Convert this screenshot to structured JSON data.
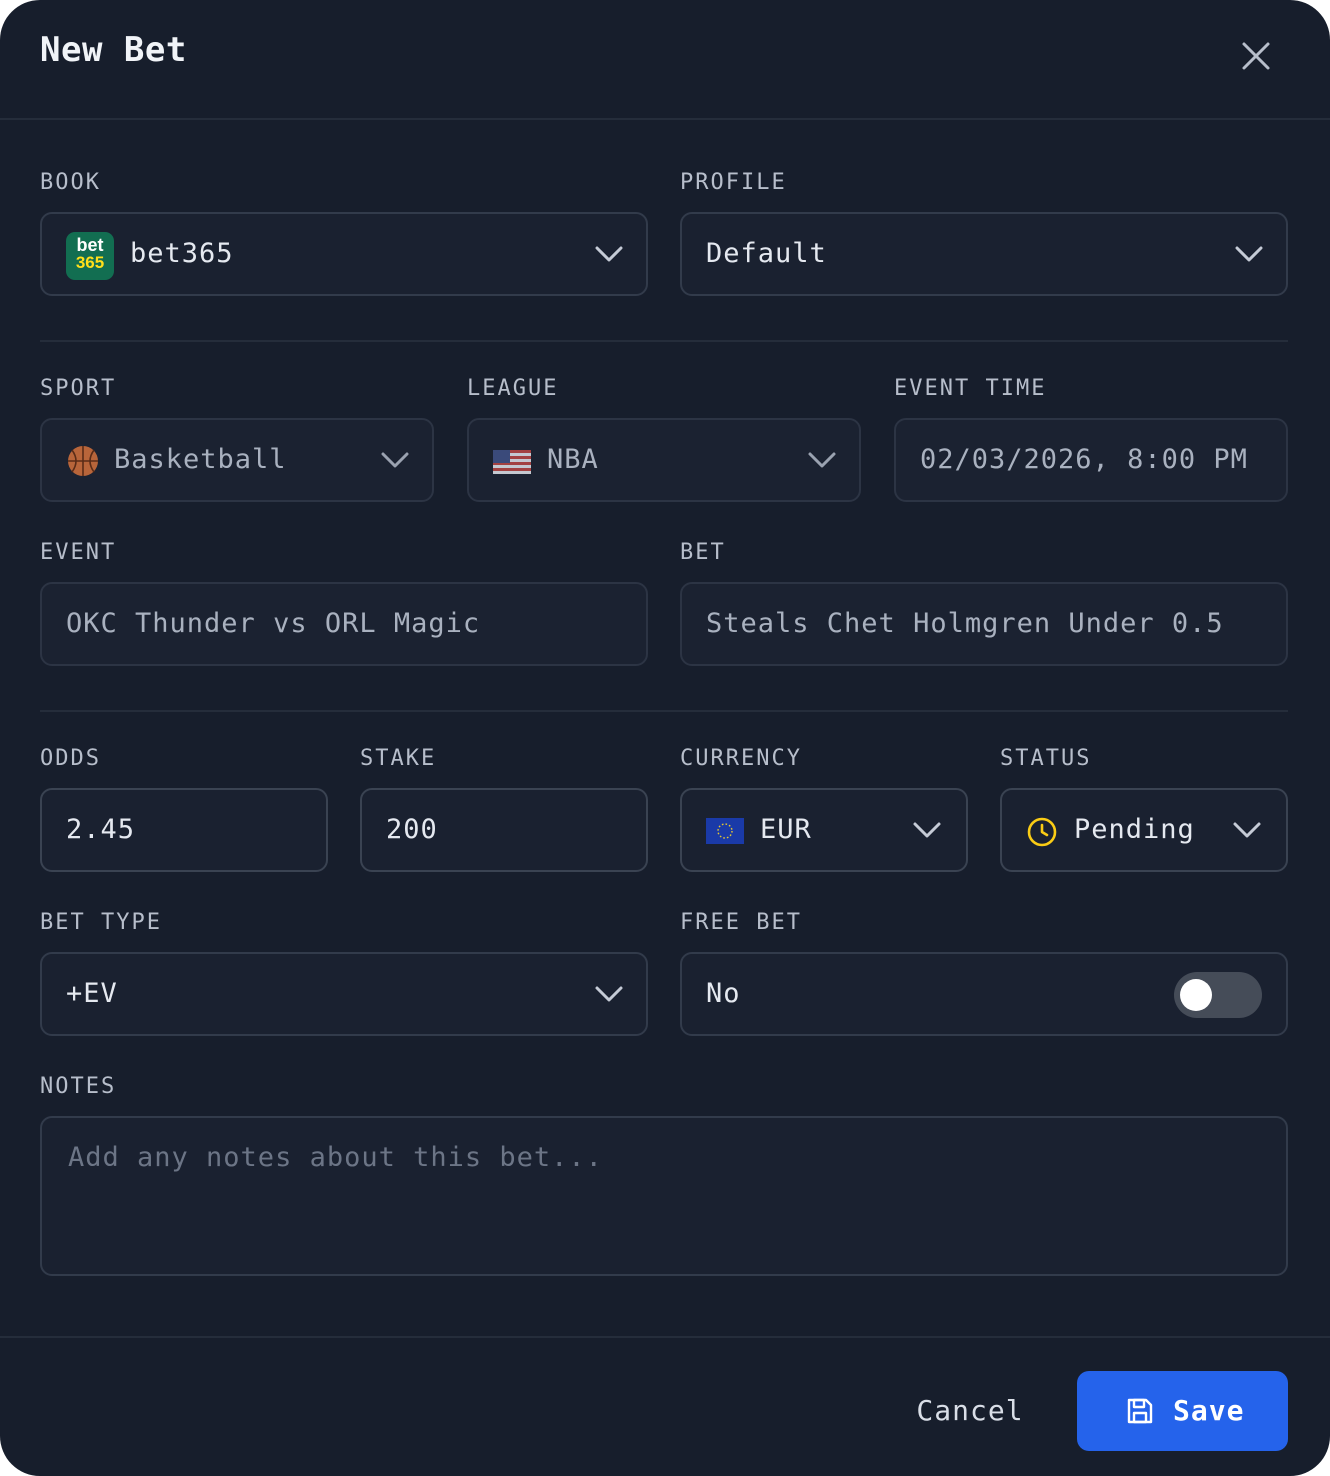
{
  "dialog": {
    "title": "New Bet",
    "close_icon": "close-icon"
  },
  "book": {
    "label": "BOOK",
    "value": "bet365",
    "logo_text_top": "bet",
    "logo_text_bottom": "365",
    "logo_color": "#126e51"
  },
  "profile": {
    "label": "PROFILE",
    "value": "Default"
  },
  "sport": {
    "label": "SPORT",
    "value": "Basketball",
    "icon": "basketball-icon"
  },
  "league": {
    "label": "LEAGUE",
    "value": "NBA",
    "icon": "us-flag-icon"
  },
  "event_time": {
    "label": "EVENT TIME",
    "value": "02/03/2026, 8:00 PM"
  },
  "event": {
    "label": "EVENT",
    "value": "OKC Thunder vs ORL Magic"
  },
  "bet": {
    "label": "BET",
    "value": "Steals Chet Holmgren Under 0.5"
  },
  "odds": {
    "label": "ODDS",
    "value": "2.45"
  },
  "stake": {
    "label": "STAKE",
    "value": "200"
  },
  "currency": {
    "label": "CURRENCY",
    "value": "EUR",
    "icon": "eu-flag-icon"
  },
  "status": {
    "label": "STATUS",
    "value": "Pending",
    "icon": "clock-icon",
    "icon_color": "#facc15"
  },
  "bet_type": {
    "label": "BET TYPE",
    "value": "+EV"
  },
  "free_bet": {
    "label": "FREE BET",
    "value": "No",
    "toggle_on": false
  },
  "notes": {
    "label": "NOTES",
    "placeholder": "Add any notes about this bet..."
  },
  "footer": {
    "cancel_label": "Cancel",
    "save_label": "Save",
    "save_icon": "save-icon",
    "accent": "#2563eb"
  }
}
